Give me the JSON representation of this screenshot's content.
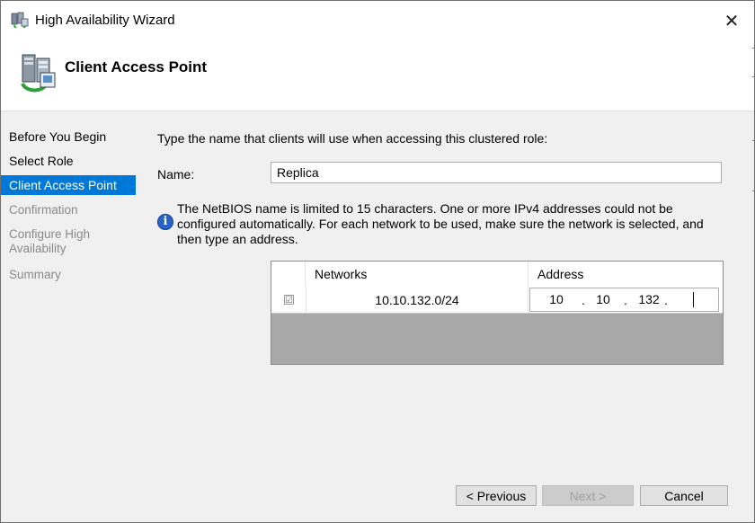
{
  "window": {
    "title": "High Availability Wizard",
    "close_glyph": "✕"
  },
  "header": {
    "title": "Client Access Point"
  },
  "sidebar": {
    "items": [
      {
        "label": "Before You Begin",
        "state": "normal"
      },
      {
        "label": "Select Role",
        "state": "normal"
      },
      {
        "label": "Client Access Point",
        "state": "active"
      },
      {
        "label": "Confirmation",
        "state": "disabled"
      },
      {
        "label": "Configure High Availability",
        "state": "disabled"
      },
      {
        "label": "Summary",
        "state": "disabled"
      }
    ]
  },
  "main": {
    "instruction": "Type the name that clients will use when accessing this clustered role:",
    "name_label": "Name:",
    "name_value": "Replica",
    "info_icon_glyph": "i",
    "info_text": "The NetBIOS name is limited to 15 characters.  One or more IPv4 addresses could not be configured automatically.  For each network to be used, make sure the network is selected, and then type an address.",
    "table": {
      "headers": [
        "Networks",
        "Address"
      ],
      "rows": [
        {
          "checked": true,
          "check_glyph": "☑",
          "network": "10.10.132.0/24",
          "address": [
            "10",
            "10",
            "132",
            ""
          ]
        }
      ]
    }
  },
  "buttons": {
    "previous": "< Previous",
    "next": "Next >",
    "cancel": "Cancel"
  },
  "colors": {
    "accent": "#0078d7",
    "sidebar_bg": "#f0f0f0",
    "table_empty_bg": "#a8a8a8"
  }
}
